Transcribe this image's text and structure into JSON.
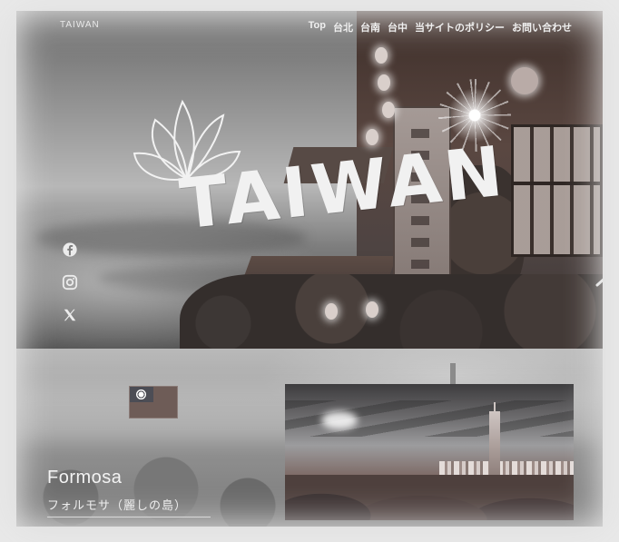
{
  "header": {
    "site_title": "TAIWAN",
    "nav": [
      "Top",
      "台北",
      "台南",
      "台中",
      "当サイトのポリシー",
      "お問い合わせ"
    ]
  },
  "hero": {
    "logo_text": "TAIWAN",
    "social": [
      "facebook-icon",
      "instagram-icon",
      "x-icon"
    ]
  },
  "intro": {
    "title": "Formosa",
    "subtitle": "フォルモサ（麗しの島）",
    "flag": "taiwan-flag"
  },
  "colors": {
    "text_light": "#f2f2f2",
    "sepia": "#5a4741"
  }
}
